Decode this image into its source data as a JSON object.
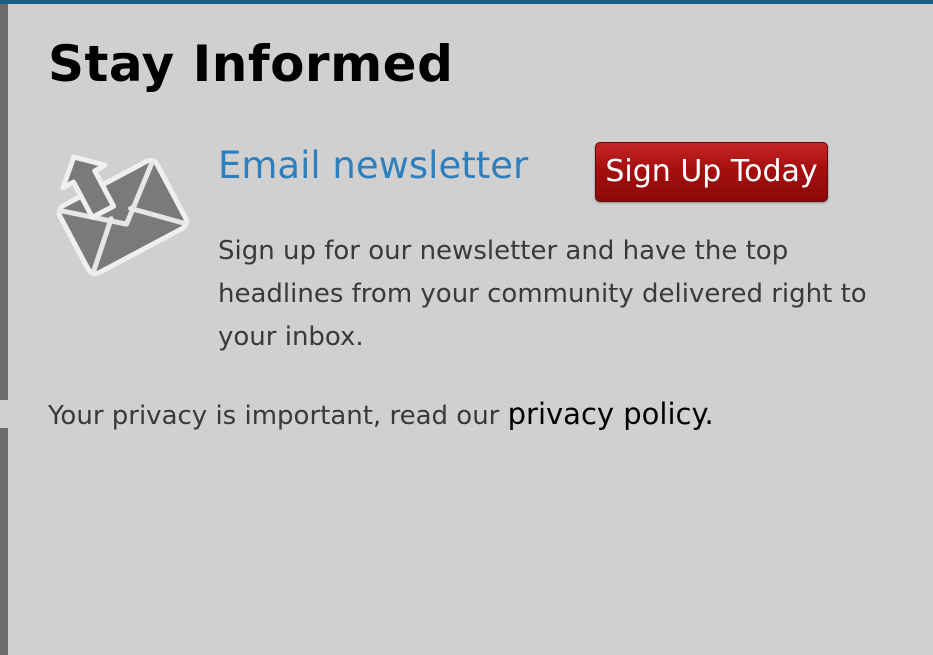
{
  "section": {
    "title": "Stay Informed",
    "newsletter": {
      "icon": "envelope-arrow-icon",
      "heading": "Email newsletter",
      "button_label": "Sign Up Today",
      "description": "Sign up for our newsletter and have the top headlines from your community delivered right to your inbox."
    },
    "privacy": {
      "text": "Your privacy is important, read our ",
      "link_label": "privacy policy."
    }
  },
  "colors": {
    "background": "#d0d0d0",
    "top_border": "#1d5f8c",
    "heading_blue": "#2e7fbd",
    "button_red": "#a50f0f",
    "body_text": "#3a3a3a"
  }
}
